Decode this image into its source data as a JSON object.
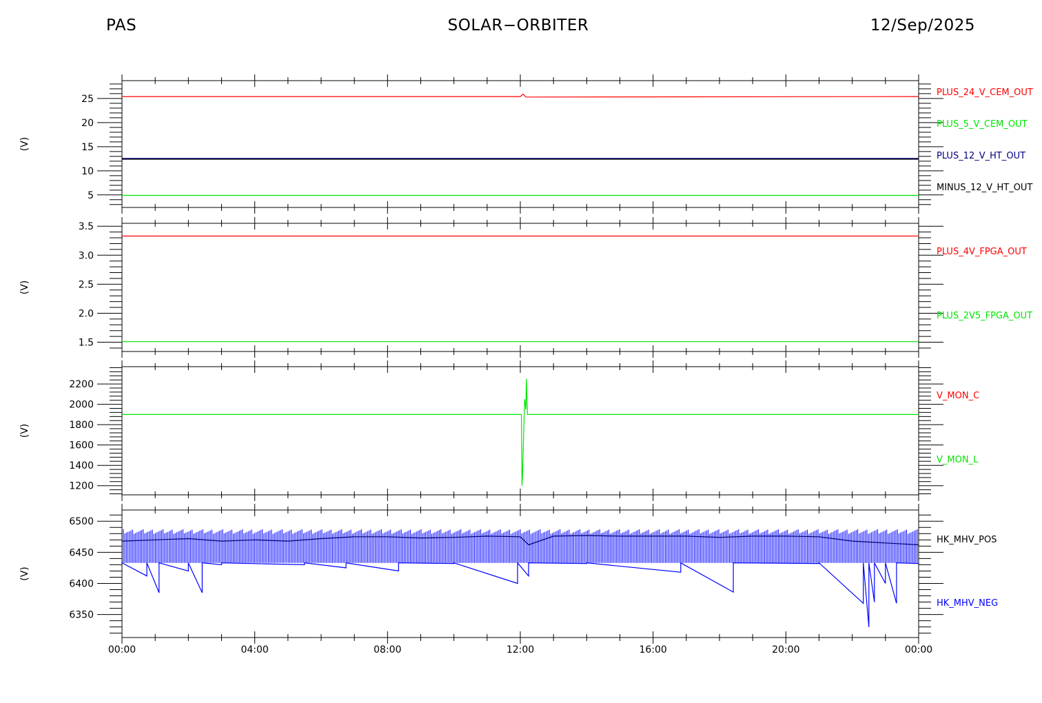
{
  "header": {
    "left": "PAS",
    "center": "SOLAR−ORBITER",
    "right": "12/Sep/2025"
  },
  "colors": {
    "red": "#ff0000",
    "green": "#00e600",
    "navy": "#000080",
    "blue": "#0000ff",
    "black": "#000000"
  },
  "chart_data": [
    {
      "type": "line",
      "ylabel": "(V)",
      "ylim": [
        2.4,
        28.7
      ],
      "yticks": [
        5,
        10,
        15,
        20,
        25
      ],
      "xlim": [
        "00:00",
        "24:00"
      ],
      "series": [
        {
          "name": "PLUS_24_V_CEM_OUT",
          "color": "red",
          "x": [
            "00:00",
            "12:00",
            "12:05",
            "12:10",
            "24:00"
          ],
          "y": [
            25.4,
            25.4,
            25.9,
            25.3,
            25.4
          ]
        },
        {
          "name": "PLUS_5_V_CEM_OUT",
          "color": "green",
          "x": [
            "00:00",
            "24:00"
          ],
          "y": [
            4.9,
            4.9
          ]
        },
        {
          "name": "PLUS_12_V_HT_OUT",
          "color": "navy",
          "x": [
            "00:00",
            "24:00"
          ],
          "y": [
            12.5,
            12.5
          ]
        },
        {
          "name": "MINUS_12_V_HT_OUT",
          "color": "black",
          "x": [
            "00:00",
            "24:00"
          ],
          "y": [
            12.4,
            12.4
          ]
        }
      ]
    },
    {
      "type": "line",
      "ylabel": "(V)",
      "ylim": [
        1.34,
        3.55
      ],
      "yticks": [
        1.5,
        2.0,
        2.5,
        3.0,
        3.5
      ],
      "xlim": [
        "00:00",
        "24:00"
      ],
      "series": [
        {
          "name": "PLUS_4V_FPGA_OUT",
          "color": "red",
          "x": [
            "00:00",
            "24:00"
          ],
          "y": [
            3.33,
            3.33
          ]
        },
        {
          "name": "PLUS_2V5_FPGA_OUT",
          "color": "green",
          "x": [
            "00:00",
            "24:00"
          ],
          "y": [
            1.51,
            1.51
          ]
        }
      ]
    },
    {
      "type": "line",
      "ylabel": "(V)",
      "ylim": [
        1110,
        2370
      ],
      "yticks": [
        1200,
        1400,
        1600,
        1800,
        2000,
        2200
      ],
      "xlim": [
        "00:00",
        "24:00"
      ],
      "series": [
        {
          "name": "V_MON_C",
          "color": "red",
          "x": [],
          "y": []
        },
        {
          "name": "V_MON_L",
          "color": "green",
          "x": [
            "00:00",
            "12:02",
            "12:03",
            "12:04",
            "12:07",
            "12:08",
            "12:10",
            "12:11",
            "12:13",
            "24:00"
          ],
          "y": [
            1900,
            1900,
            1200,
            1300,
            1900,
            2050,
            1950,
            2250,
            1900,
            1900
          ]
        }
      ]
    },
    {
      "type": "line",
      "ylabel": "(V)",
      "ylim": [
        6313,
        6518
      ],
      "yticks": [
        6350,
        6400,
        6450,
        6500
      ],
      "xlim": [
        "00:00",
        "24:00"
      ],
      "series": [
        {
          "name": "HK_MHV_POS",
          "color": "black",
          "x": [
            "00:00",
            "01:00",
            "02:00",
            "03:00",
            "04:00",
            "05:00",
            "06:00",
            "07:00",
            "08:00",
            "09:00",
            "10:00",
            "11:00",
            "12:00",
            "12:15",
            "13:00",
            "14:00",
            "15:00",
            "16:00",
            "17:00",
            "18:00",
            "19:00",
            "20:00",
            "21:00",
            "22:00",
            "23:00",
            "24:00"
          ],
          "y": [
            6468,
            6470,
            6472,
            6468,
            6470,
            6468,
            6472,
            6475,
            6475,
            6473,
            6474,
            6476,
            6475,
            6462,
            6476,
            6477,
            6476,
            6476,
            6476,
            6474,
            6476,
            6476,
            6475,
            6468,
            6465,
            6462
          ]
        },
        {
          "name": "HK_MHV_NEG",
          "color": "blue",
          "x": [
            "00:00",
            "00:45",
            "01:07",
            "02:00",
            "02:25",
            "03:00",
            "05:30",
            "06:45",
            "08:20",
            "10:00",
            "11:55",
            "12:15",
            "14:00",
            "16:50",
            "18:25",
            "21:00",
            "22:20",
            "22:30",
            "22:40",
            "23:00",
            "23:20",
            "24:00"
          ],
          "y": [
            6435,
            6412,
            6385,
            6420,
            6385,
            6430,
            6430,
            6425,
            6420,
            6432,
            6400,
            6412,
            6432,
            6418,
            6386,
            6432,
            6368,
            6330,
            6370,
            6400,
            6368,
            6432
          ],
          "band": [
            6433,
            6487
          ]
        }
      ]
    }
  ],
  "xaxis": {
    "ticks": [
      "00:00",
      "04:00",
      "08:00",
      "12:00",
      "16:00",
      "20:00",
      "00:00"
    ]
  }
}
